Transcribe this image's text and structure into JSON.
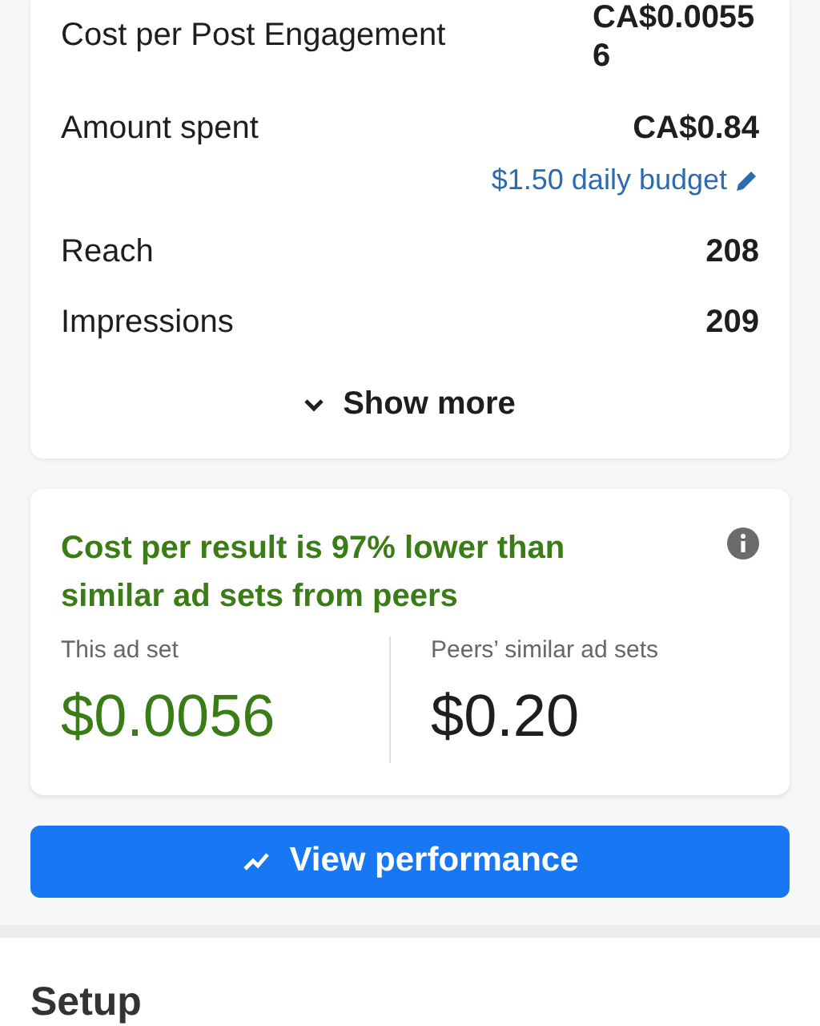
{
  "metrics": [
    {
      "label": "Cost per Post Engagement",
      "value": "CA$0.00556"
    },
    {
      "label": "Amount spent",
      "value": "CA$0.84",
      "link": "$1.50 daily budget"
    },
    {
      "label": "Reach",
      "value": "208"
    },
    {
      "label": "Impressions",
      "value": "209"
    }
  ],
  "show_more": "Show more",
  "comparison": {
    "headline": "Cost per result is 97% lower than similar ad sets from peers",
    "columns": [
      {
        "label": "This ad set",
        "value": "$0.0056",
        "kind": "highlight"
      },
      {
        "label": "Peers’ similar ad sets",
        "value": "$0.20",
        "kind": "plain"
      }
    ]
  },
  "action_button": "View performance",
  "section_title": "Setup"
}
